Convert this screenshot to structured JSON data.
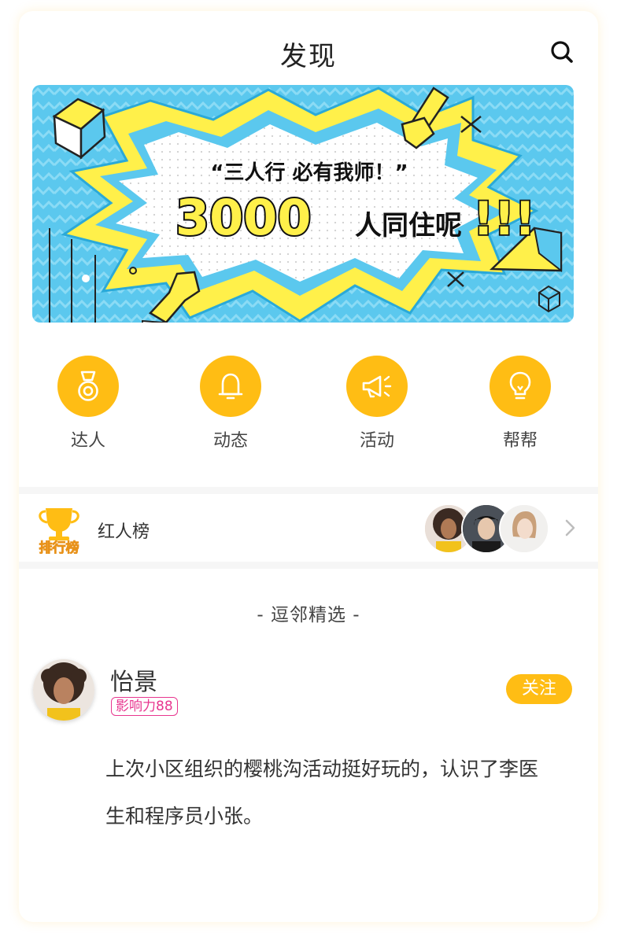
{
  "header": {
    "title": "发现",
    "search_icon": "search-icon"
  },
  "banner": {
    "quote": "“三人行 必有我师！”",
    "number": "3000",
    "suffix": "人同住呢",
    "exclaim": "!!!",
    "colors": {
      "sky": "#5BC8EE",
      "yellow": "#FFF04A",
      "dark": "#222222"
    }
  },
  "quick_nav": [
    {
      "label": "达人",
      "icon": "medal-icon"
    },
    {
      "label": "动态",
      "icon": "bell-icon"
    },
    {
      "label": "活动",
      "icon": "megaphone-icon"
    },
    {
      "label": "帮帮",
      "icon": "lightbulb-icon"
    }
  ],
  "ranking": {
    "badge": "排行榜",
    "label": "红人榜",
    "avatars": [
      "avatar-curly-hair",
      "avatar-dark-hair",
      "avatar-light-hair"
    ]
  },
  "section": {
    "title": "- 逗邻精选 -"
  },
  "post": {
    "author": "怡景",
    "badge": "影响力88",
    "follow_label": "关注",
    "body": "上次小区组织的樱桃沟活动挺好玩的，认识了李医生和程序员小张。"
  },
  "colors": {
    "accent": "#FFBD14",
    "badge": "#E8368F"
  }
}
